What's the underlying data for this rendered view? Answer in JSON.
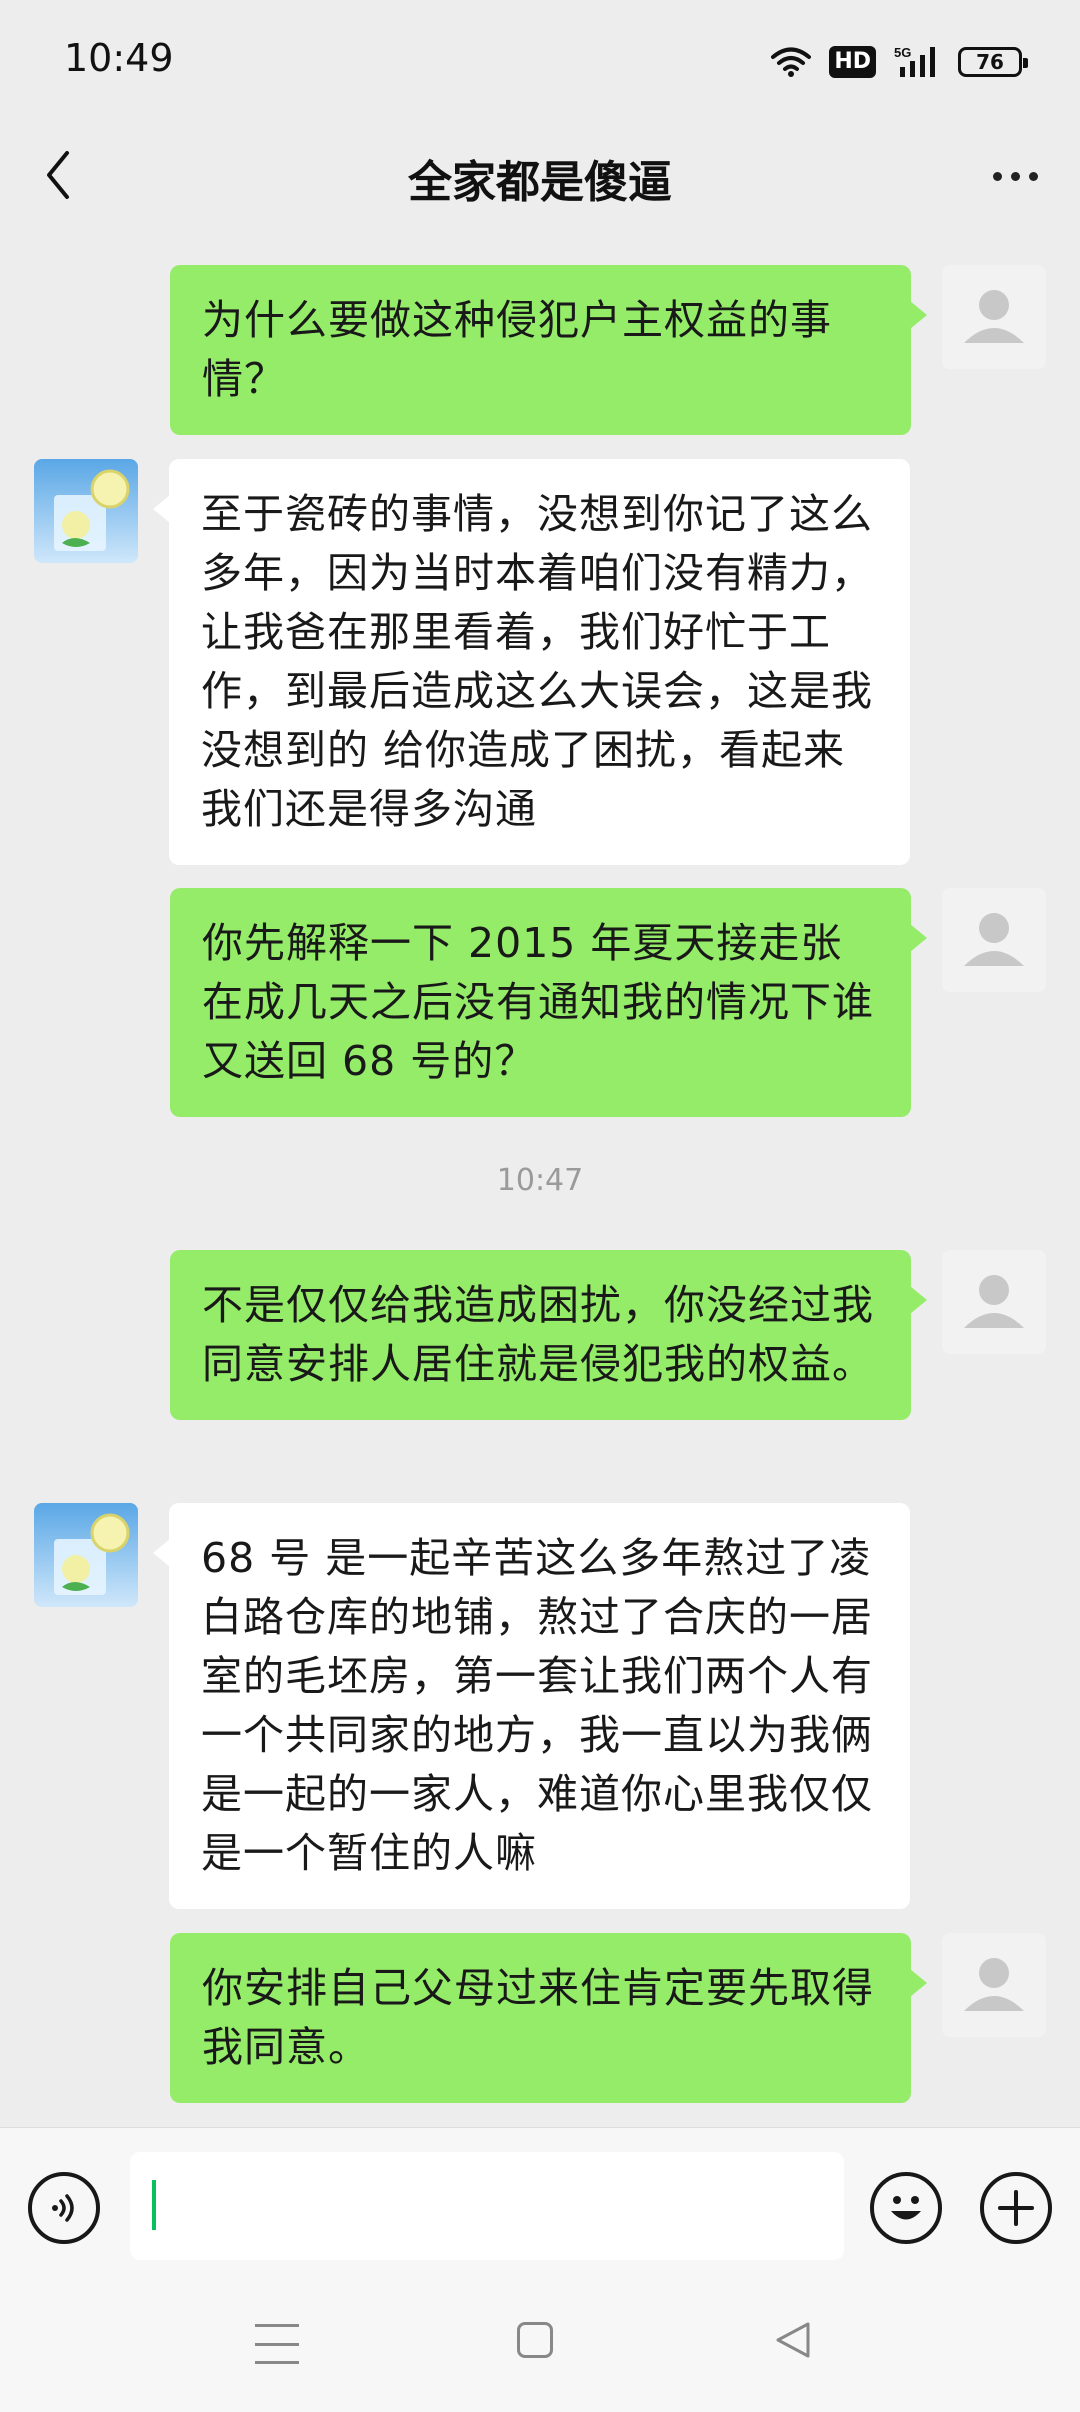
{
  "status_bar": {
    "time": "10:49",
    "hd_label": "HD",
    "network_label": "5G",
    "battery": "76"
  },
  "header": {
    "title": "全家都是傻逼"
  },
  "messages": [
    {
      "side": "out",
      "text": "为什么要做这种侵犯户主权益的事情？"
    },
    {
      "side": "in",
      "text": "至于瓷砖的事情，没想到你记了这么多年，因为当时本着咱们没有精力，让我爸在那里看着，我们好忙于工作，到最后造成这么大误会，这是我没想到的 给你造成了困扰，看起来我们还是得多沟通"
    },
    {
      "side": "out",
      "text": "你先解释一下 2015 年夏天接走张在成几天之后没有通知我的情况下谁又送回 68 号的？"
    },
    {
      "type": "time",
      "text": "10:47"
    },
    {
      "side": "out",
      "text": "不是仅仅给我造成困扰，你没经过我同意安排人居住就是侵犯我的权益。"
    },
    {
      "side": "in",
      "text": "68 号 是一起辛苦这么多年熬过了凌白路仓库的地铺，熬过了合庆的一居室的毛坯房，第一套让我们两个人有一个共同家的地方，我一直以为我俩是一起的一家人，难道你心里我仅仅是一个暂住的人嘛"
    },
    {
      "side": "out",
      "text": "你安排自己父母过来住肯定要先取得我同意。"
    }
  ],
  "input": {
    "value": ""
  }
}
